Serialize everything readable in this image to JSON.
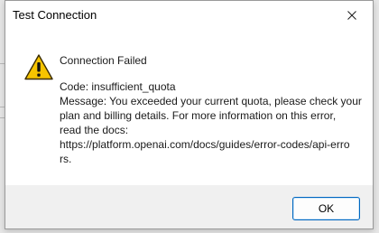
{
  "window": {
    "title": "Test Connection"
  },
  "dialog": {
    "icon": "warning-icon",
    "heading": "Connection Failed",
    "lines": [
      "Code: insufficient_quota",
      "Message: You exceeded your current quota, please check your",
      "plan and billing details. For more information on this error,",
      "read the docs:",
      "https://platform.openai.com/docs/guides/error-codes/api-erro",
      "rs."
    ]
  },
  "buttons": {
    "ok_label": "OK"
  },
  "colors": {
    "accent": "#0067c0",
    "warning_fill": "#f6c400",
    "warning_outline": "#3a2c00"
  }
}
